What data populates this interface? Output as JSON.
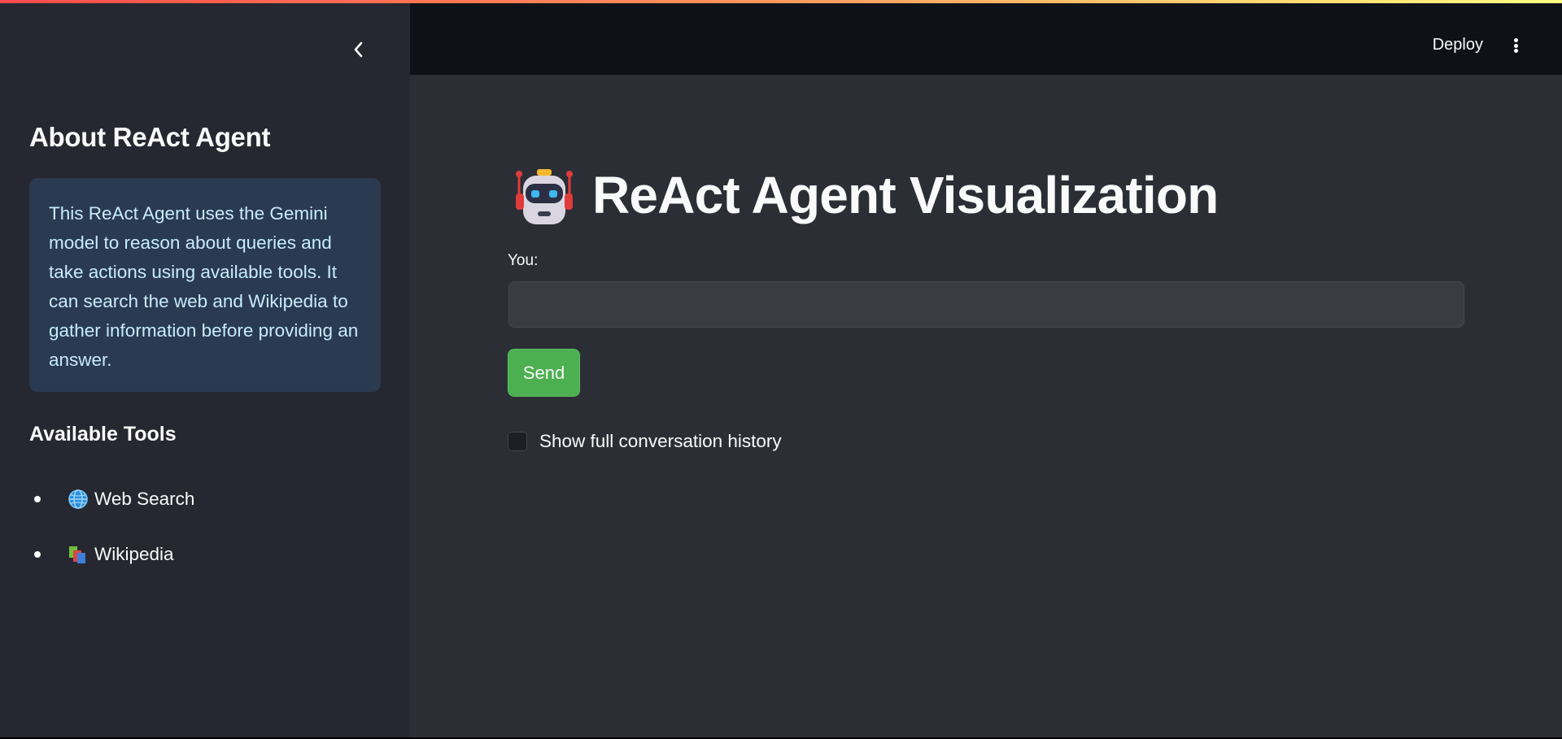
{
  "sidebar": {
    "title": "About ReAct Agent",
    "info_text": "This ReAct Agent uses the Gemini model to reason about queries and take actions using available tools. It can search the web and Wikipedia to gather information before providing an answer.",
    "tools_heading": "Available Tools",
    "tools": [
      {
        "icon": "globe-icon",
        "label": "Web Search"
      },
      {
        "icon": "books-icon",
        "label": "Wikipedia"
      }
    ],
    "collapse_icon": "chevron-left-icon"
  },
  "header": {
    "deploy_label": "Deploy",
    "menu_icon": "more-vertical-icon"
  },
  "main": {
    "title_icon": "robot-icon",
    "title": "ReAct Agent Visualization",
    "input_label": "You:",
    "input_value": "",
    "send_label": "Send",
    "history_checkbox_label": "Show full conversation history",
    "history_checkbox_checked": false
  },
  "colors": {
    "sidebar_bg": "#262730",
    "main_bg": "#2b2f35",
    "header_bg": "#0e1117",
    "info_bg": "#2a3a50",
    "info_text": "#c7ebff",
    "send_button": "#4caf50"
  }
}
